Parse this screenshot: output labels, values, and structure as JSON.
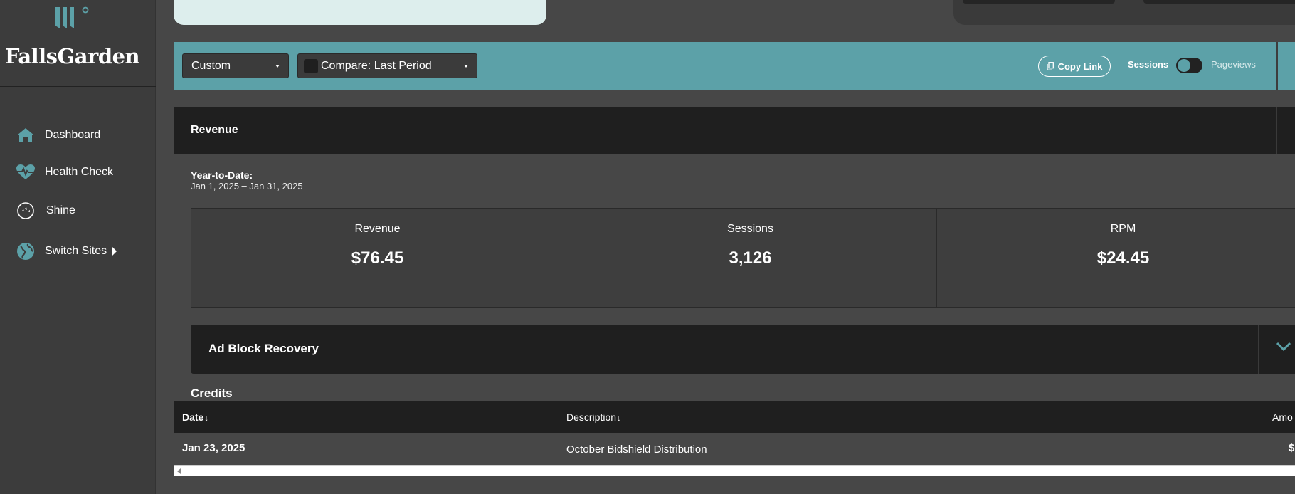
{
  "brand": {
    "name": "FallsGarden",
    "logo_icon": "falls-logo-icon",
    "accent": "#5ca1a8"
  },
  "sidebar": {
    "items": [
      {
        "label": "Dashboard",
        "icon": "home-icon"
      },
      {
        "label": "Health Check",
        "icon": "heartbeat-icon"
      },
      {
        "label": "Shine",
        "icon": "sparkle-icon"
      },
      {
        "label": "Switch Sites",
        "icon": "globe-icon",
        "has_submenu": true
      }
    ]
  },
  "filters": {
    "range_value": "Custom",
    "compare_value": "Compare: Last Period",
    "compare_checked": false,
    "copy_link_label": "Copy Link",
    "toggle_left_label": "Sessions",
    "toggle_right_label": "Pageviews",
    "toggle_state": "Sessions"
  },
  "revenue": {
    "title": "Revenue",
    "ytd_label": "Year-to-Date:",
    "ytd_range": "Jan 1, 2025 – Jan 31, 2025",
    "metrics": [
      {
        "label": "Revenue",
        "value": "$76.45"
      },
      {
        "label": "Sessions",
        "value": "3,126"
      },
      {
        "label": "RPM",
        "value": "$24.45"
      }
    ]
  },
  "ad_block": {
    "title": "Ad Block Recovery",
    "expanded": false
  },
  "credits": {
    "title": "Credits",
    "columns": [
      {
        "label": "Date",
        "sort_icon": "↓"
      },
      {
        "label": "Description",
        "sort_icon": "↓"
      },
      {
        "label": "Amo"
      }
    ],
    "rows": [
      {
        "date": "Jan 23, 2025",
        "description": "October Bidshield Distribution",
        "amount": "$"
      }
    ]
  }
}
